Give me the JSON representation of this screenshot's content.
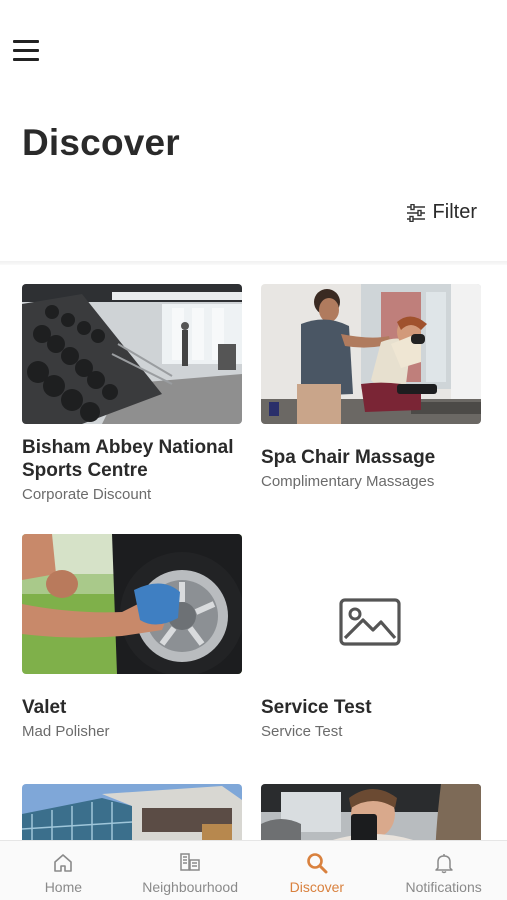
{
  "header": {
    "title": "Discover",
    "filter_label": "Filter",
    "menu_icon": "hamburger-menu-icon",
    "filter_icon": "sliders-icon"
  },
  "cards": [
    {
      "title": "Bisham Abbey National Sports Centre",
      "subtitle": "Corporate Discount",
      "image": "gym-dumbbell-rack-photo"
    },
    {
      "title": "Spa Chair Massage",
      "subtitle": "Complimentary Massages",
      "image": "chair-massage-photo"
    },
    {
      "title": "Valet",
      "subtitle": "Mad Polisher",
      "image": "car-wheel-polishing-photo"
    },
    {
      "title": "Service Test",
      "subtitle": "Service Test",
      "image": "image-placeholder-icon"
    },
    {
      "title": "",
      "subtitle": "",
      "image": "office-building-photo"
    },
    {
      "title": "",
      "subtitle": "",
      "image": "people-with-phone-photo"
    }
  ],
  "nav": {
    "items": [
      {
        "label": "Home",
        "icon": "home-icon"
      },
      {
        "label": "Neighbourhood",
        "icon": "neighbourhood-icon"
      },
      {
        "label": "Discover",
        "icon": "search-icon"
      },
      {
        "label": "Notifications",
        "icon": "bell-icon"
      }
    ],
    "active_index": 2
  },
  "colors": {
    "accent": "#d9813e",
    "text": "#2a2a2a",
    "muted": "#6b6b6b",
    "nav_inactive": "#8a8a8a"
  }
}
